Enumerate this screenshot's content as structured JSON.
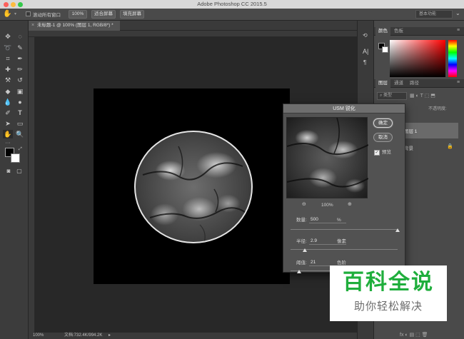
{
  "app": {
    "title": "Adobe Photoshop CC 2015.5"
  },
  "options_bar": {
    "scroll_all_windows": "滚动所有窗口",
    "zoom_100": "100%",
    "fit_screen": "适合屏幕",
    "fill_screen": "填充屏幕",
    "workspace": "基本功能"
  },
  "document": {
    "tab_title": "未标题-1 @ 100% (图层 1, RGB/8*) *"
  },
  "status": {
    "zoom": "100%",
    "doc_size": "文档:732.4K/994.2K"
  },
  "panels": {
    "color_tab": "颜色",
    "swatches_tab": "色板",
    "layers_tab": "图层",
    "channels_tab": "通道",
    "paths_tab": "路径",
    "kind_filter": "类型",
    "opacity_label": "不透明度:",
    "layer_name": "图层 1",
    "background_layer": "背景"
  },
  "dialog": {
    "title": "USM 锐化",
    "ok": "确定",
    "cancel": "取消",
    "preview_label": "预览",
    "zoom": "100%",
    "amount_label": "数量:",
    "amount_value": "500",
    "amount_unit": "%",
    "amount_fraction": 1.0,
    "radius_label": "半径:",
    "radius_value": "2.9",
    "radius_unit": "像素",
    "radius_fraction": 0.13,
    "threshold_label": "阈值:",
    "threshold_value": "21",
    "threshold_unit": "色阶",
    "threshold_fraction": 0.08
  },
  "watermark": {
    "main": "百科全说",
    "sub": "助你轻松解决"
  },
  "colors": {
    "watermark_green": "#1fae3c",
    "canvas": "#000000",
    "workspace": "#282828"
  }
}
